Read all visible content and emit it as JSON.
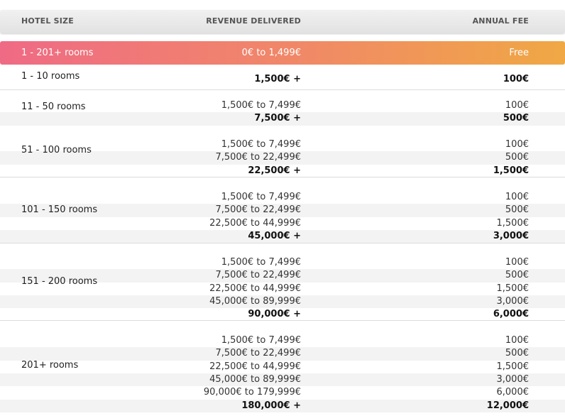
{
  "header": {
    "size_label": "HOTEL SIZE",
    "revenue_label": "REVENUE DELIVERED",
    "fee_label": "ANNUAL FEE"
  },
  "highlight": {
    "size": "1 - 201+ rooms",
    "revenue": "0€ to 1,499€",
    "fee": "Free"
  },
  "groups": [
    {
      "label": "1 - 10 rooms",
      "tiers": [
        {
          "revenue": "1,500€ +",
          "fee": "100€"
        }
      ]
    },
    {
      "label": "11 - 50 rooms",
      "tiers": [
        {
          "revenue": "1,500€ to 7,499€",
          "fee": "100€"
        },
        {
          "revenue": "7,500€ +",
          "fee": "500€"
        }
      ]
    },
    {
      "label": "51 - 100 rooms",
      "tiers": [
        {
          "revenue": "1,500€ to 7,499€",
          "fee": "100€"
        },
        {
          "revenue": "7,500€ to 22,499€",
          "fee": "500€"
        },
        {
          "revenue": "22,500€ +",
          "fee": "1,500€"
        }
      ]
    },
    {
      "label": "101 - 150 rooms",
      "tiers": [
        {
          "revenue": "1,500€ to 7,499€",
          "fee": "100€"
        },
        {
          "revenue": "7,500€ to 22,499€",
          "fee": "500€"
        },
        {
          "revenue": "22,500€ to 44,999€",
          "fee": "1,500€"
        },
        {
          "revenue": "45,000€ +",
          "fee": "3,000€"
        }
      ]
    },
    {
      "label": "151 - 200 rooms",
      "tiers": [
        {
          "revenue": "1,500€ to 7,499€",
          "fee": "100€"
        },
        {
          "revenue": "7,500€ to 22,499€",
          "fee": "500€"
        },
        {
          "revenue": "22,500€ to 44,999€",
          "fee": "1,500€"
        },
        {
          "revenue": "45,000€ to 89,999€",
          "fee": "3,000€"
        },
        {
          "revenue": "90,000€ +",
          "fee": "6,000€"
        }
      ]
    },
    {
      "label": "201+ rooms",
      "tiers": [
        {
          "revenue": "1,500€ to 7,499€",
          "fee": "100€"
        },
        {
          "revenue": "7,500€ to 22,499€",
          "fee": "500€"
        },
        {
          "revenue": "22,500€ to 44,999€",
          "fee": "1,500€"
        },
        {
          "revenue": "45,000€ to 89,999€",
          "fee": "3,000€"
        },
        {
          "revenue": "90,000€ to 179,999€",
          "fee": "6,000€"
        },
        {
          "revenue": "180,000€ +",
          "fee": "12,000€"
        }
      ]
    }
  ]
}
